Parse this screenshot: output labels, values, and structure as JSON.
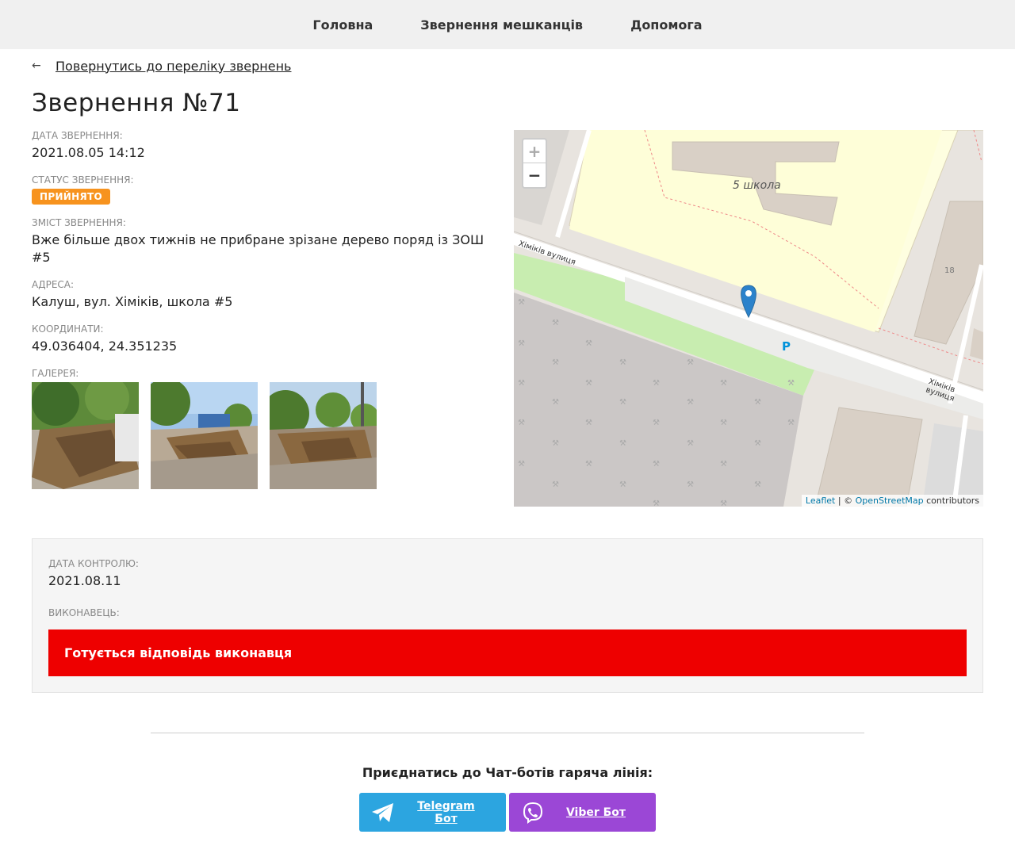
{
  "nav": {
    "items": [
      "Головна",
      "Звернення мешканців",
      "Допомога"
    ]
  },
  "back_link": "Повернутись до переліку звернень",
  "title": "Звернення №71",
  "fields": {
    "date_label": "Дата звернення:",
    "date_value": "2021.08.05 14:12",
    "status_label": "Статус звернення:",
    "status_value": "Прийнято",
    "content_label": "Зміст звернення:",
    "content_value": "Вже більше двох тижнів не прибране зрізане дерево поряд із ЗОШ #5",
    "address_label": "Адреса:",
    "address_value": "Калуш, вул. Хіміків, школа #5",
    "coords_label": "Координати:",
    "coords_value": "49.036404, 24.351235",
    "gallery_label": "Галерея:"
  },
  "map": {
    "zoom_in": "+",
    "zoom_out": "−",
    "label_school": "5 школа",
    "label_street_1": "Хіміків вулиця",
    "label_street_2": "Хіміків вулиця",
    "label_house": "18",
    "label_parking": "P",
    "attribution_leaflet": "Leaflet",
    "attribution_sep": " | © ",
    "attribution_osm": "OpenStreetMap",
    "attribution_tail": " contributors"
  },
  "control": {
    "date_label": "Дата контролю:",
    "date_value": "2021.08.11",
    "executor_label": "Виконавець:",
    "status_text": "Готується відповідь виконавця"
  },
  "footer": {
    "join_title": "Приєднатись до Чат-ботів гаряча лінія:",
    "telegram_label": "Telegram Бот",
    "viber_label": "Viber Бот"
  },
  "colors": {
    "badge": "#f7931e",
    "status_bar": "#ee0000",
    "telegram": "#2ca5e0",
    "viber": "#9b47d6",
    "leaflet_link": "#0078a8"
  }
}
